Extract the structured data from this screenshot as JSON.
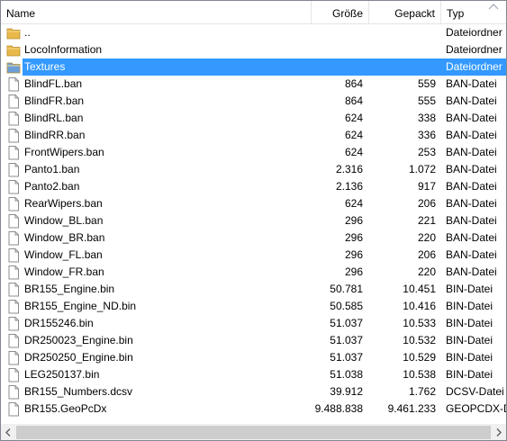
{
  "columns": {
    "name": "Name",
    "size": "Größe",
    "packed": "Gepackt",
    "type": "Typ"
  },
  "colors": {
    "selection": "#3399ff",
    "folder": "#e8b84a",
    "folder_selected": "#6d9fd6"
  },
  "rows": [
    {
      "icon": "folder-icon",
      "name": "..",
      "size": "",
      "packed": "",
      "type": "Dateiordner"
    },
    {
      "icon": "folder-icon",
      "name": "LocoInformation",
      "size": "",
      "packed": "",
      "type": "Dateiordner"
    },
    {
      "icon": "folder-icon",
      "name": "Textures",
      "size": "",
      "packed": "",
      "type": "Dateiordner",
      "selected": true
    },
    {
      "icon": "file-icon",
      "name": "BlindFL.ban",
      "size": "864",
      "packed": "559",
      "type": "BAN-Datei"
    },
    {
      "icon": "file-icon",
      "name": "BlindFR.ban",
      "size": "864",
      "packed": "555",
      "type": "BAN-Datei"
    },
    {
      "icon": "file-icon",
      "name": "BlindRL.ban",
      "size": "624",
      "packed": "338",
      "type": "BAN-Datei"
    },
    {
      "icon": "file-icon",
      "name": "BlindRR.ban",
      "size": "624",
      "packed": "336",
      "type": "BAN-Datei"
    },
    {
      "icon": "file-icon",
      "name": "FrontWipers.ban",
      "size": "624",
      "packed": "253",
      "type": "BAN-Datei"
    },
    {
      "icon": "file-icon",
      "name": "Panto1.ban",
      "size": "2.316",
      "packed": "1.072",
      "type": "BAN-Datei"
    },
    {
      "icon": "file-icon",
      "name": "Panto2.ban",
      "size": "2.136",
      "packed": "917",
      "type": "BAN-Datei"
    },
    {
      "icon": "file-icon",
      "name": "RearWipers.ban",
      "size": "624",
      "packed": "206",
      "type": "BAN-Datei"
    },
    {
      "icon": "file-icon",
      "name": "Window_BL.ban",
      "size": "296",
      "packed": "221",
      "type": "BAN-Datei"
    },
    {
      "icon": "file-icon",
      "name": "Window_BR.ban",
      "size": "296",
      "packed": "220",
      "type": "BAN-Datei"
    },
    {
      "icon": "file-icon",
      "name": "Window_FL.ban",
      "size": "296",
      "packed": "206",
      "type": "BAN-Datei"
    },
    {
      "icon": "file-icon",
      "name": "Window_FR.ban",
      "size": "296",
      "packed": "220",
      "type": "BAN-Datei"
    },
    {
      "icon": "file-icon",
      "name": "BR155_Engine.bin",
      "size": "50.781",
      "packed": "10.451",
      "type": "BIN-Datei"
    },
    {
      "icon": "file-icon",
      "name": "BR155_Engine_ND.bin",
      "size": "50.585",
      "packed": "10.416",
      "type": "BIN-Datei"
    },
    {
      "icon": "file-icon",
      "name": "DR155246.bin",
      "size": "51.037",
      "packed": "10.533",
      "type": "BIN-Datei"
    },
    {
      "icon": "file-icon",
      "name": "DR250023_Engine.bin",
      "size": "51.037",
      "packed": "10.532",
      "type": "BIN-Datei"
    },
    {
      "icon": "file-icon",
      "name": "DR250250_Engine.bin",
      "size": "51.037",
      "packed": "10.529",
      "type": "BIN-Datei"
    },
    {
      "icon": "file-icon",
      "name": "LEG250137.bin",
      "size": "51.038",
      "packed": "10.538",
      "type": "BIN-Datei"
    },
    {
      "icon": "file-icon",
      "name": "BR155_Numbers.dcsv",
      "size": "39.912",
      "packed": "1.762",
      "type": "DCSV-Datei"
    },
    {
      "icon": "file-icon",
      "name": "BR155.GeoPcDx",
      "size": "9.488.838",
      "packed": "9.461.233",
      "type": "GEOPCDX-Dat"
    }
  ]
}
